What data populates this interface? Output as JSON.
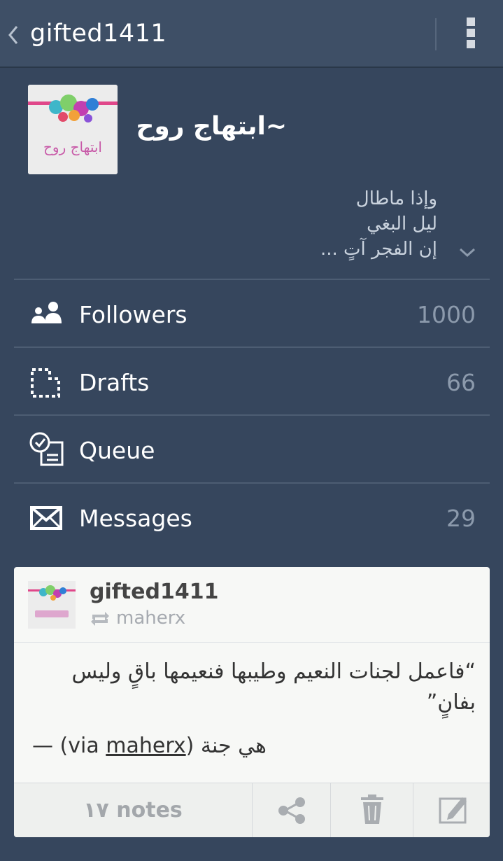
{
  "topbar": {
    "title": "gifted1411"
  },
  "blog": {
    "avatar_text": "ابتهاج روح",
    "title": "~ابتهاج روح",
    "description": [
      "وإذا ماطال",
      "ليل البغي",
      "إن الفجر آتٍ ..."
    ]
  },
  "menu": [
    {
      "label": "Followers",
      "count": "1000",
      "icon": "followers-icon"
    },
    {
      "label": "Drafts",
      "count": "66",
      "icon": "drafts-icon"
    },
    {
      "label": "Queue",
      "count": "",
      "icon": "queue-icon"
    },
    {
      "label": "Messages",
      "count": "29",
      "icon": "mail-icon"
    }
  ],
  "post": {
    "user": "gifted1411",
    "reblogged_from": "maherx",
    "quote": "“فاعمل لجنات النعيم وطيبها فنعيمها باقٍ وليس بفانٍ”",
    "source_prefix": "— (via ",
    "source_link": "maherx",
    "source_suffix": ") هي جنة",
    "notes": "١٧ notes"
  },
  "colors": {
    "background": "#36465d",
    "topbar": "#3e4f66",
    "card": "#f7f8f6"
  }
}
